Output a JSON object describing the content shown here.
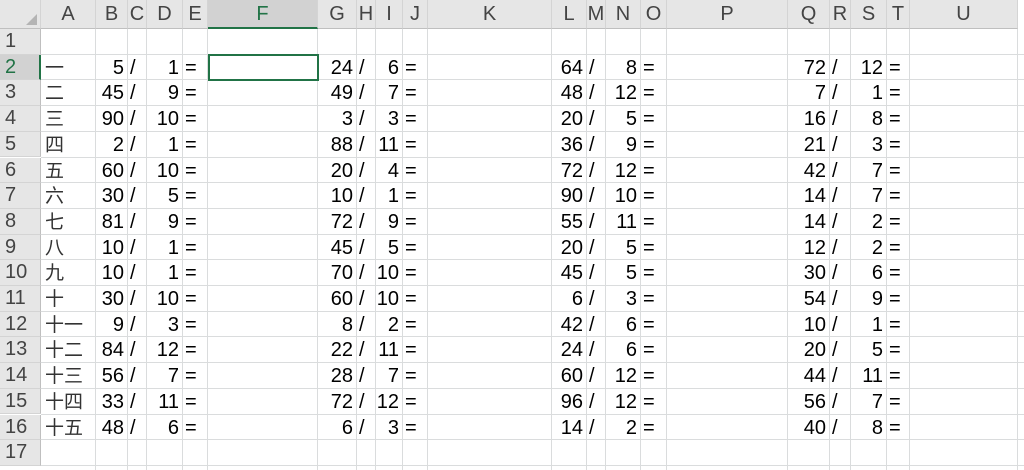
{
  "columns": [
    "A",
    "B",
    "C",
    "D",
    "E",
    "F",
    "G",
    "H",
    "I",
    "J",
    "K",
    "L",
    "M",
    "N",
    "O",
    "P",
    "Q",
    "R",
    "S",
    "T",
    "U"
  ],
  "rows": [
    "1",
    "2",
    "3",
    "4",
    "5",
    "6",
    "7",
    "8",
    "9",
    "10",
    "11",
    "12",
    "13",
    "14",
    "15",
    "16",
    "17"
  ],
  "active_column": "F",
  "active_row": "2",
  "selected_cell": "F2",
  "cells": [
    {
      "label": "一",
      "p1": [
        "5",
        "/",
        "1",
        "="
      ],
      "p2": [
        "24",
        "/",
        "6",
        "="
      ],
      "p3": [
        "64",
        "/",
        "8",
        "="
      ],
      "p4": [
        "72",
        "/",
        "12",
        "="
      ]
    },
    {
      "label": "二",
      "p1": [
        "45",
        "/",
        "9",
        "="
      ],
      "p2": [
        "49",
        "/",
        "7",
        "="
      ],
      "p3": [
        "48",
        "/",
        "12",
        "="
      ],
      "p4": [
        "7",
        "/",
        "1",
        "="
      ]
    },
    {
      "label": "三",
      "p1": [
        "90",
        "/",
        "10",
        "="
      ],
      "p2": [
        "3",
        "/",
        "3",
        "="
      ],
      "p3": [
        "20",
        "/",
        "5",
        "="
      ],
      "p4": [
        "16",
        "/",
        "8",
        "="
      ]
    },
    {
      "label": "四",
      "p1": [
        "2",
        "/",
        "1",
        "="
      ],
      "p2": [
        "88",
        "/",
        "11",
        "="
      ],
      "p3": [
        "36",
        "/",
        "9",
        "="
      ],
      "p4": [
        "21",
        "/",
        "3",
        "="
      ]
    },
    {
      "label": "五",
      "p1": [
        "60",
        "/",
        "10",
        "="
      ],
      "p2": [
        "20",
        "/",
        "4",
        "="
      ],
      "p3": [
        "72",
        "/",
        "12",
        "="
      ],
      "p4": [
        "42",
        "/",
        "7",
        "="
      ]
    },
    {
      "label": "六",
      "p1": [
        "30",
        "/",
        "5",
        "="
      ],
      "p2": [
        "10",
        "/",
        "1",
        "="
      ],
      "p3": [
        "90",
        "/",
        "10",
        "="
      ],
      "p4": [
        "14",
        "/",
        "7",
        "="
      ]
    },
    {
      "label": "七",
      "p1": [
        "81",
        "/",
        "9",
        "="
      ],
      "p2": [
        "72",
        "/",
        "9",
        "="
      ],
      "p3": [
        "55",
        "/",
        "11",
        "="
      ],
      "p4": [
        "14",
        "/",
        "2",
        "="
      ]
    },
    {
      "label": "八",
      "p1": [
        "10",
        "/",
        "1",
        "="
      ],
      "p2": [
        "45",
        "/",
        "5",
        "="
      ],
      "p3": [
        "20",
        "/",
        "5",
        "="
      ],
      "p4": [
        "12",
        "/",
        "2",
        "="
      ]
    },
    {
      "label": "九",
      "p1": [
        "10",
        "/",
        "1",
        "="
      ],
      "p2": [
        "70",
        "/",
        "10",
        "="
      ],
      "p3": [
        "45",
        "/",
        "5",
        "="
      ],
      "p4": [
        "30",
        "/",
        "6",
        "="
      ]
    },
    {
      "label": "十",
      "p1": [
        "30",
        "/",
        "10",
        "="
      ],
      "p2": [
        "60",
        "/",
        "10",
        "="
      ],
      "p3": [
        "6",
        "/",
        "3",
        "="
      ],
      "p4": [
        "54",
        "/",
        "9",
        "="
      ]
    },
    {
      "label": "十一",
      "p1": [
        "9",
        "/",
        "3",
        "="
      ],
      "p2": [
        "8",
        "/",
        "2",
        "="
      ],
      "p3": [
        "42",
        "/",
        "6",
        "="
      ],
      "p4": [
        "10",
        "/",
        "1",
        "="
      ]
    },
    {
      "label": "十二",
      "p1": [
        "84",
        "/",
        "12",
        "="
      ],
      "p2": [
        "22",
        "/",
        "11",
        "="
      ],
      "p3": [
        "24",
        "/",
        "6",
        "="
      ],
      "p4": [
        "20",
        "/",
        "5",
        "="
      ]
    },
    {
      "label": "十三",
      "p1": [
        "56",
        "/",
        "7",
        "="
      ],
      "p2": [
        "28",
        "/",
        "7",
        "="
      ],
      "p3": [
        "60",
        "/",
        "12",
        "="
      ],
      "p4": [
        "44",
        "/",
        "11",
        "="
      ]
    },
    {
      "label": "十四",
      "p1": [
        "33",
        "/",
        "11",
        "="
      ],
      "p2": [
        "72",
        "/",
        "12",
        "="
      ],
      "p3": [
        "96",
        "/",
        "12",
        "="
      ],
      "p4": [
        "56",
        "/",
        "7",
        "="
      ]
    },
    {
      "label": "十五",
      "p1": [
        "48",
        "/",
        "6",
        "="
      ],
      "p2": [
        "6",
        "/",
        "3",
        "="
      ],
      "p3": [
        "14",
        "/",
        "2",
        "="
      ],
      "p4": [
        "40",
        "/",
        "8",
        "="
      ]
    }
  ]
}
